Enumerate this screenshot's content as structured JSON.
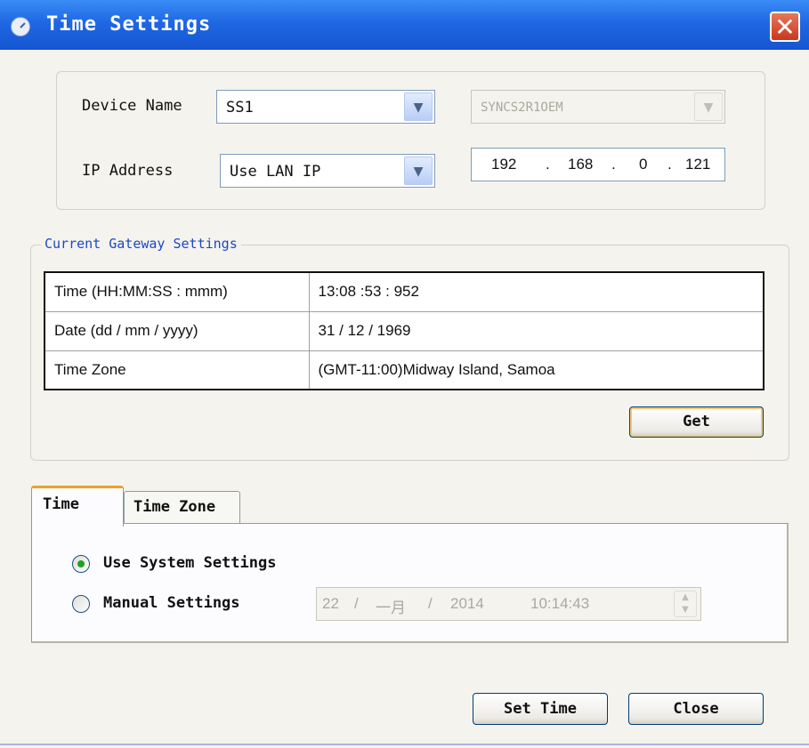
{
  "window": {
    "title": "Time Settings",
    "close_glyph": "✕"
  },
  "device": {
    "name_label": "Device Name",
    "name_value": "SS1",
    "model_value": "SYNCS2R1OEM",
    "ip_label": "IP Address",
    "ip_mode_value": "Use LAN IP",
    "ip_octets": [
      "192",
      "168",
      "0",
      "121"
    ]
  },
  "gateway": {
    "legend": "Current Gateway Settings",
    "rows": [
      {
        "key": "Time (HH:MM:SS : mmm)",
        "value": "13:08 :53 : 952"
      },
      {
        "key": "Date (dd / mm / yyyy)",
        "value": "31 / 12 / 1969"
      },
      {
        "key": "Time Zone",
        "value": "(GMT-11:00)Midway Island, Samoa"
      }
    ],
    "get_label": "Get"
  },
  "tabs": {
    "time": "Time",
    "time_zone": "Time Zone"
  },
  "time_tab": {
    "system_label": "Use System Settings",
    "manual_label": "Manual Settings",
    "manual_day": "22",
    "manual_month": "一月",
    "manual_year": "2014",
    "manual_time": "10:14:43"
  },
  "buttons": {
    "set_time": "Set Time",
    "close": "Close"
  },
  "icons": [
    "clock-icon",
    "close-icon",
    "chevron-down-icon",
    "radio-icon",
    "spin-icon"
  ]
}
